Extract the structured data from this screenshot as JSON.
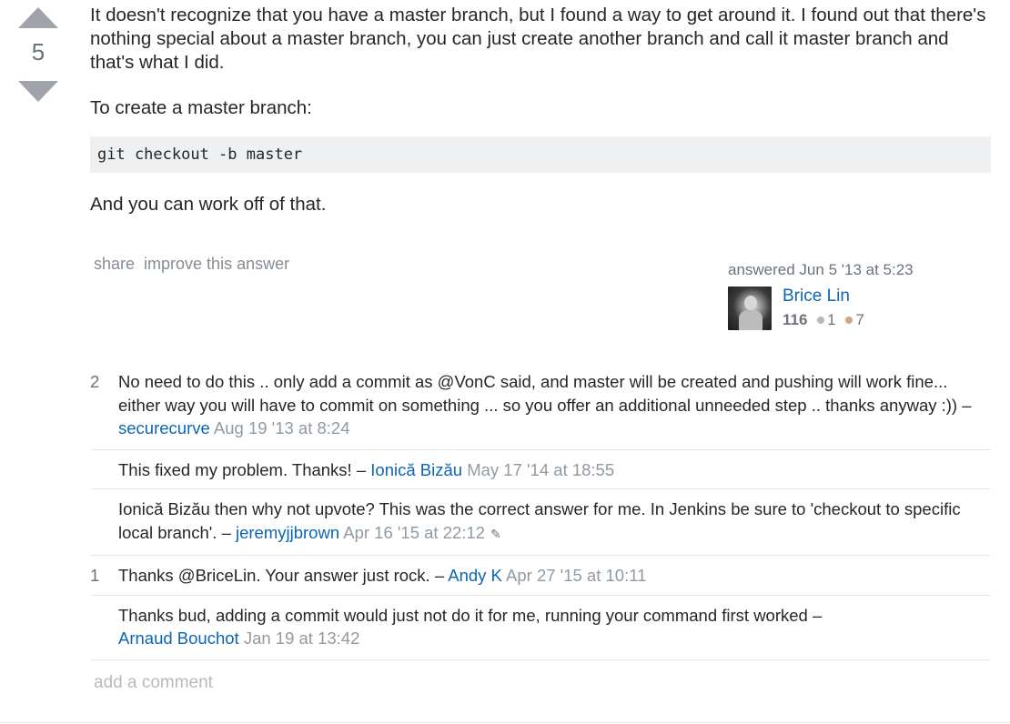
{
  "vote": {
    "count": "5"
  },
  "answer": {
    "paragraphs": [
      "It doesn't recognize that you have a master branch, but I found a way to get around it. I found out that there's nothing special about a master branch, you can just create another branch and call it master branch and that's what I did.",
      "To create a master branch:",
      "And you can work off of that."
    ],
    "code": "git checkout -b master"
  },
  "post_menu": {
    "share": "share",
    "improve": "improve this answer"
  },
  "user_card": {
    "action": "answered Jun 5 '13 at 5:23",
    "name": "Brice Lin",
    "reputation": "116",
    "silver": "1",
    "bronze": "7"
  },
  "comments": [
    {
      "score": "2",
      "text": "No need to do this .. only add a commit as @VonC said, and master will be created and pushing will work fine... either way you will have to commit on something ... so you offer an additional unneeded step .. thanks anyway :)) –",
      "user": "securecurve",
      "date": "Aug 19 '13 at 8:24"
    },
    {
      "score": "",
      "text": "This fixed my problem. Thanks! –",
      "user": "Ionică Bizău",
      "date": "May 17 '14 at 18:55"
    },
    {
      "score": "",
      "text": "Ionică Bizău then why not upvote? This was the correct answer for me. In Jenkins be sure to 'checkout to specific local branch'. –",
      "user": "jeremyjjbrown",
      "date": "Apr 16 '15 at 22:12"
    },
    {
      "score": "1",
      "text": "Thanks @BriceLin. Your answer just rock. –",
      "user": "Andy K",
      "date": "Apr 27 '15 at 10:11"
    },
    {
      "score": "",
      "text": "Thanks bud, adding a commit would just not do it for me, running your command first worked –",
      "user": "Arnaud Bouchot",
      "date": "Jan 19 at 13:42"
    }
  ],
  "add_comment": "add a comment"
}
